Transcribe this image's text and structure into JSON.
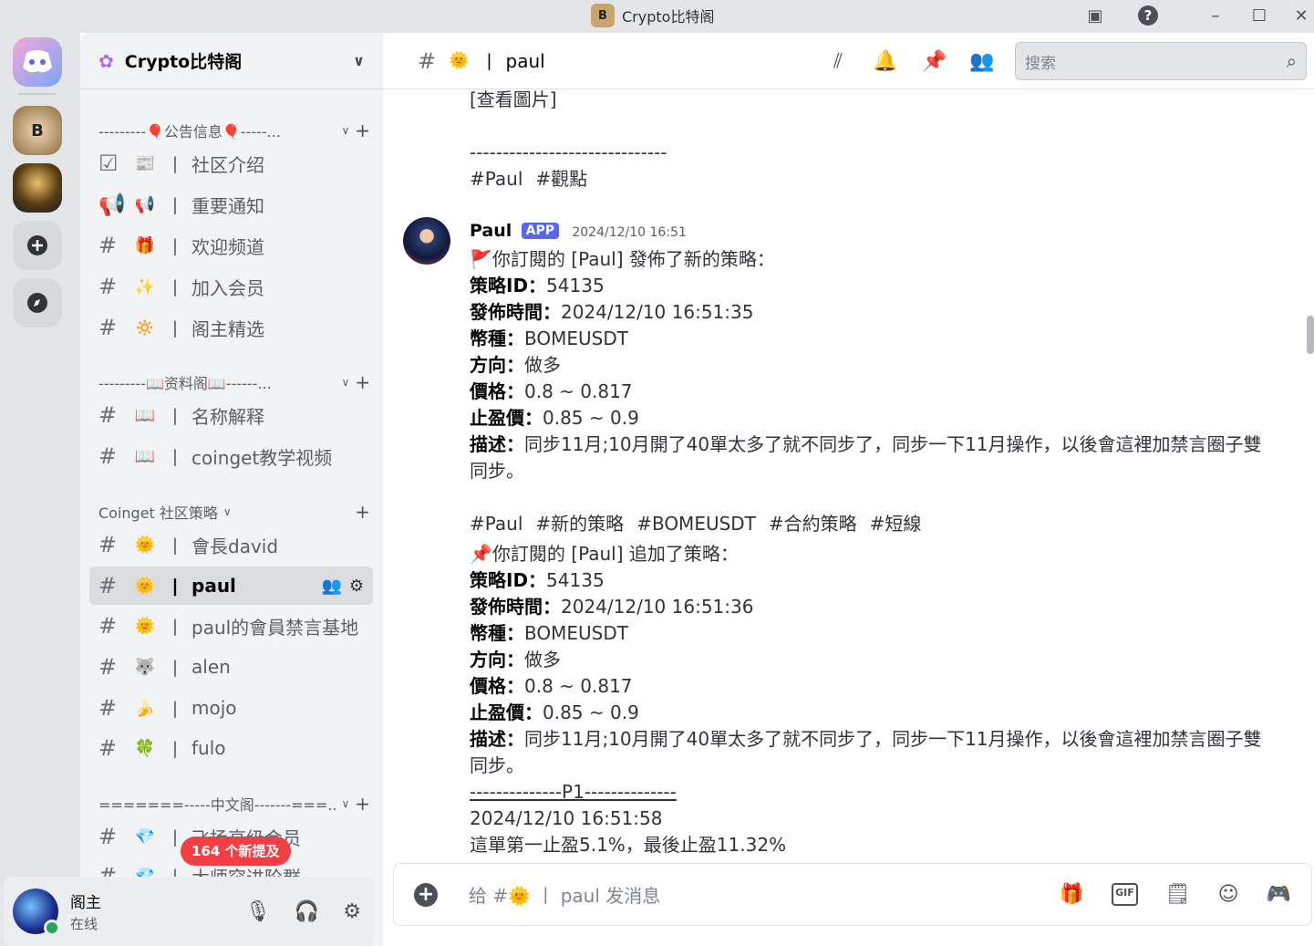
{
  "window": {
    "title": "Crypto比特阁"
  },
  "guilds": {
    "badge": "164"
  },
  "server": {
    "name": "Crypto比特阁"
  },
  "categories": [
    {
      "label": "---------🎈公告信息🎈-----..."
    },
    {
      "label": "---------📖资料阁📖------..."
    },
    {
      "label": "Coinget 社区策略"
    },
    {
      "label": "=======-----中文阁-------===..."
    }
  ],
  "channels": [
    {
      "icon": "☑",
      "emoji": "📰",
      "name": "社区介绍"
    },
    {
      "icon": "📢",
      "emoji": "📢",
      "name": "重要通知"
    },
    {
      "icon": "#",
      "emoji": "🎁",
      "name": "欢迎频道"
    },
    {
      "icon": "#",
      "emoji": "✨",
      "name": "加入会员"
    },
    {
      "icon": "#",
      "emoji": "🔅",
      "name": "阁主精选"
    },
    {
      "icon": "#",
      "emoji": "📖",
      "name": "名称解释"
    },
    {
      "icon": "#",
      "emoji": "📖",
      "name": "coinget教学视频"
    },
    {
      "icon": "#",
      "emoji": "🌞",
      "name": "會長david"
    },
    {
      "icon": "#",
      "emoji": "🌞",
      "name": "paul"
    },
    {
      "icon": "#",
      "emoji": "🌞",
      "name": "paul的會員禁言基地"
    },
    {
      "icon": "#",
      "emoji": "🐺",
      "name": "alen"
    },
    {
      "icon": "#",
      "emoji": "🍌",
      "name": "mojo"
    },
    {
      "icon": "#",
      "emoji": "🍀",
      "name": "fulo"
    },
    {
      "icon": "#",
      "emoji": "💎",
      "name": "飞扬高级会员"
    },
    {
      "icon": "#",
      "emoji": "💎",
      "name": "大师突进阶群"
    }
  ],
  "new_mentions": "164 个新提及",
  "user": {
    "name": "阁主",
    "status": "在线"
  },
  "channel_header": {
    "emoji": "🌞",
    "name": "paul"
  },
  "search": {
    "placeholder": "搜索"
  },
  "messages": {
    "prev": {
      "view_image": "[查看圖片]",
      "divider": "------------------------------",
      "tags": [
        "#Paul",
        "#觀點"
      ]
    },
    "author": "Paul",
    "badge": "APP",
    "timestamp": "2024/12/10 16:51",
    "m1": {
      "head": "你訂閱的 [Paul] 發佈了新的策略：",
      "rows": [
        {
          "k": "策略ID：",
          "v": "54135"
        },
        {
          "k": "發佈時間：",
          "v": "2024/12/10 16:51:35"
        },
        {
          "k": "幣種：",
          "v": "BOMEUSDT"
        },
        {
          "k": "方向：",
          "v": "做多"
        },
        {
          "k": "價格：",
          "v": "0.8 ~ 0.817"
        },
        {
          "k": "止盈價：",
          "v": "0.85 ~ 0.9"
        }
      ],
      "desc_k": "描述：",
      "desc_v": "同步11月;10月開了40單太多了就不同步了，同步一下11月操作，以後會這裡加禁言圈子雙",
      "desc_v2": "同步。",
      "tags": [
        "#Paul",
        "#新的策略",
        "#BOMEUSDT",
        "#合約策略",
        "#短線"
      ]
    },
    "m2": {
      "head": "你訂閱的 [Paul] 追加了策略：",
      "rows": [
        {
          "k": "策略ID：",
          "v": "54135"
        },
        {
          "k": "發佈時間：",
          "v": "2024/12/10 16:51:36"
        },
        {
          "k": "幣種：",
          "v": "BOMEUSDT"
        },
        {
          "k": "方向：",
          "v": "做多"
        },
        {
          "k": "價格：",
          "v": "0.8 ~ 0.817"
        },
        {
          "k": "止盈價：",
          "v": "0.85 ~ 0.9"
        }
      ],
      "desc_k": "描述：",
      "desc_v": "同步11月;10月開了40單太多了就不同步了，同步一下11月操作，以後會這裡加禁言圈子雙",
      "desc_v2": "同步。",
      "p1": "--------------P1--------------",
      "p1_time": "2024/12/10 16:51:58",
      "p1_text": "這單第一止盈5.1%，最後止盈11.32%"
    }
  },
  "composer": {
    "placeholder": "给 #🌞 丨 paul 发消息"
  }
}
